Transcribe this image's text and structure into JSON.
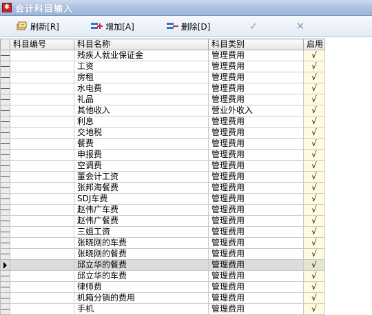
{
  "window": {
    "title": "会计科目输入"
  },
  "toolbar": {
    "refresh_label": "刷新[R]",
    "add_label": "增加[A]",
    "delete_label": "删除[D]",
    "confirm_symbol": "✓",
    "cancel_symbol": "✕"
  },
  "columns": [
    "科目编号",
    "科目名称",
    "科目类别",
    "启用"
  ],
  "rows": [
    {
      "code": "",
      "name": "残疾人就业保证金",
      "category": "管理费用",
      "enabled": "√"
    },
    {
      "code": "",
      "name": "工资",
      "category": "管理费用",
      "enabled": "√"
    },
    {
      "code": "",
      "name": "房租",
      "category": "管理费用",
      "enabled": "√"
    },
    {
      "code": "",
      "name": "水电费",
      "category": "管理费用",
      "enabled": "√"
    },
    {
      "code": "",
      "name": "礼品",
      "category": "管理费用",
      "enabled": "√"
    },
    {
      "code": "",
      "name": "其他收入",
      "category": "营业外收入",
      "enabled": "√"
    },
    {
      "code": "",
      "name": "利息",
      "category": "管理费用",
      "enabled": "√"
    },
    {
      "code": "",
      "name": "交地税",
      "category": "管理费用",
      "enabled": "√"
    },
    {
      "code": "",
      "name": "餐费",
      "category": "管理费用",
      "enabled": "√"
    },
    {
      "code": "",
      "name": "申报费",
      "category": "管理费用",
      "enabled": "√"
    },
    {
      "code": "",
      "name": "空调费",
      "category": "管理费用",
      "enabled": "√"
    },
    {
      "code": "",
      "name": "董会计工资",
      "category": "管理费用",
      "enabled": "√"
    },
    {
      "code": "",
      "name": "张邦海餐费",
      "category": "管理费用",
      "enabled": "√"
    },
    {
      "code": "",
      "name": "SDJ车费",
      "category": "管理费用",
      "enabled": "√"
    },
    {
      "code": "",
      "name": "赵伟广车费",
      "category": "管理费用",
      "enabled": "√"
    },
    {
      "code": "",
      "name": "赵伟广餐费",
      "category": "管理费用",
      "enabled": "√"
    },
    {
      "code": "",
      "name": "三姐工资",
      "category": "管理费用",
      "enabled": "√"
    },
    {
      "code": "",
      "name": "张晓刚的车费",
      "category": "管理费用",
      "enabled": "√"
    },
    {
      "code": "",
      "name": "张晓刚的餐费",
      "category": "管理费用",
      "enabled": "√"
    },
    {
      "code": "",
      "name": "邱立华的餐费",
      "category": "管理费用",
      "enabled": "√",
      "selected": true
    },
    {
      "code": "",
      "name": "邱立华的车费",
      "category": "管理费用",
      "enabled": "√"
    },
    {
      "code": "",
      "name": "律师费",
      "category": "管理费用",
      "enabled": "√"
    },
    {
      "code": "",
      "name": "机箱分销的费用",
      "category": "管理费用",
      "enabled": "√"
    },
    {
      "code": "",
      "name": "手机",
      "category": "管理费用",
      "enabled": "√"
    }
  ]
}
